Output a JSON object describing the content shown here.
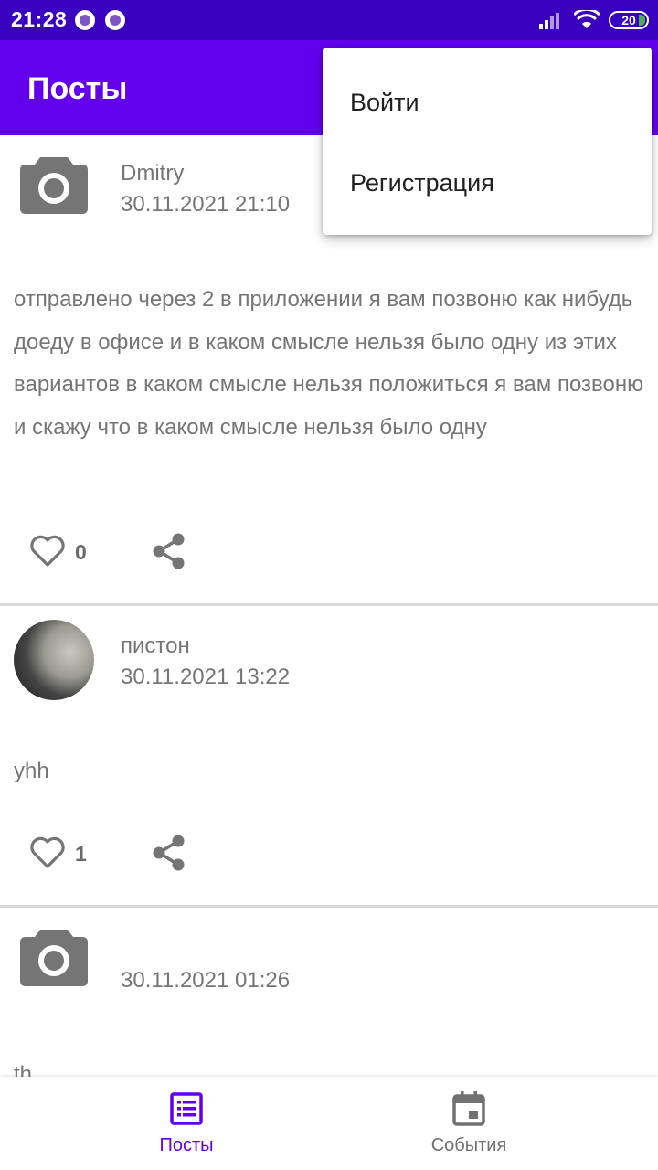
{
  "status_bar": {
    "time": "21:28",
    "battery": "20"
  },
  "app_bar": {
    "title": "Посты"
  },
  "menu": {
    "items": [
      {
        "label": "Войти"
      },
      {
        "label": "Регистрация"
      }
    ]
  },
  "posts": [
    {
      "author": "Dmitry",
      "date": "30.11.2021 21:10",
      "avatar": "camera-icon",
      "content": "отправлено через 2 в приложении я вам позвоню как нибудь доеду в офисе и в каком смысле нельзя было одну из этих вариантов в каком смысле нельзя положиться я вам позвоню и скажу что в каком смысле нельзя было одну",
      "likes": "0"
    },
    {
      "author": "пистон",
      "date": "30.11.2021 13:22",
      "avatar": "photo",
      "content": "yhh",
      "likes": "1"
    },
    {
      "author": "",
      "date": "30.11.2021 01:26",
      "avatar": "camera-icon",
      "content": "th"
    }
  ],
  "bottom_nav": {
    "items": [
      {
        "label": "Посты",
        "icon": "list-icon",
        "active": true
      },
      {
        "label": "События",
        "icon": "calendar-icon",
        "active": false
      }
    ]
  },
  "colors": {
    "primary": "#6200ee",
    "status_bar": "#3a00c0",
    "icon_gray": "#757575"
  }
}
